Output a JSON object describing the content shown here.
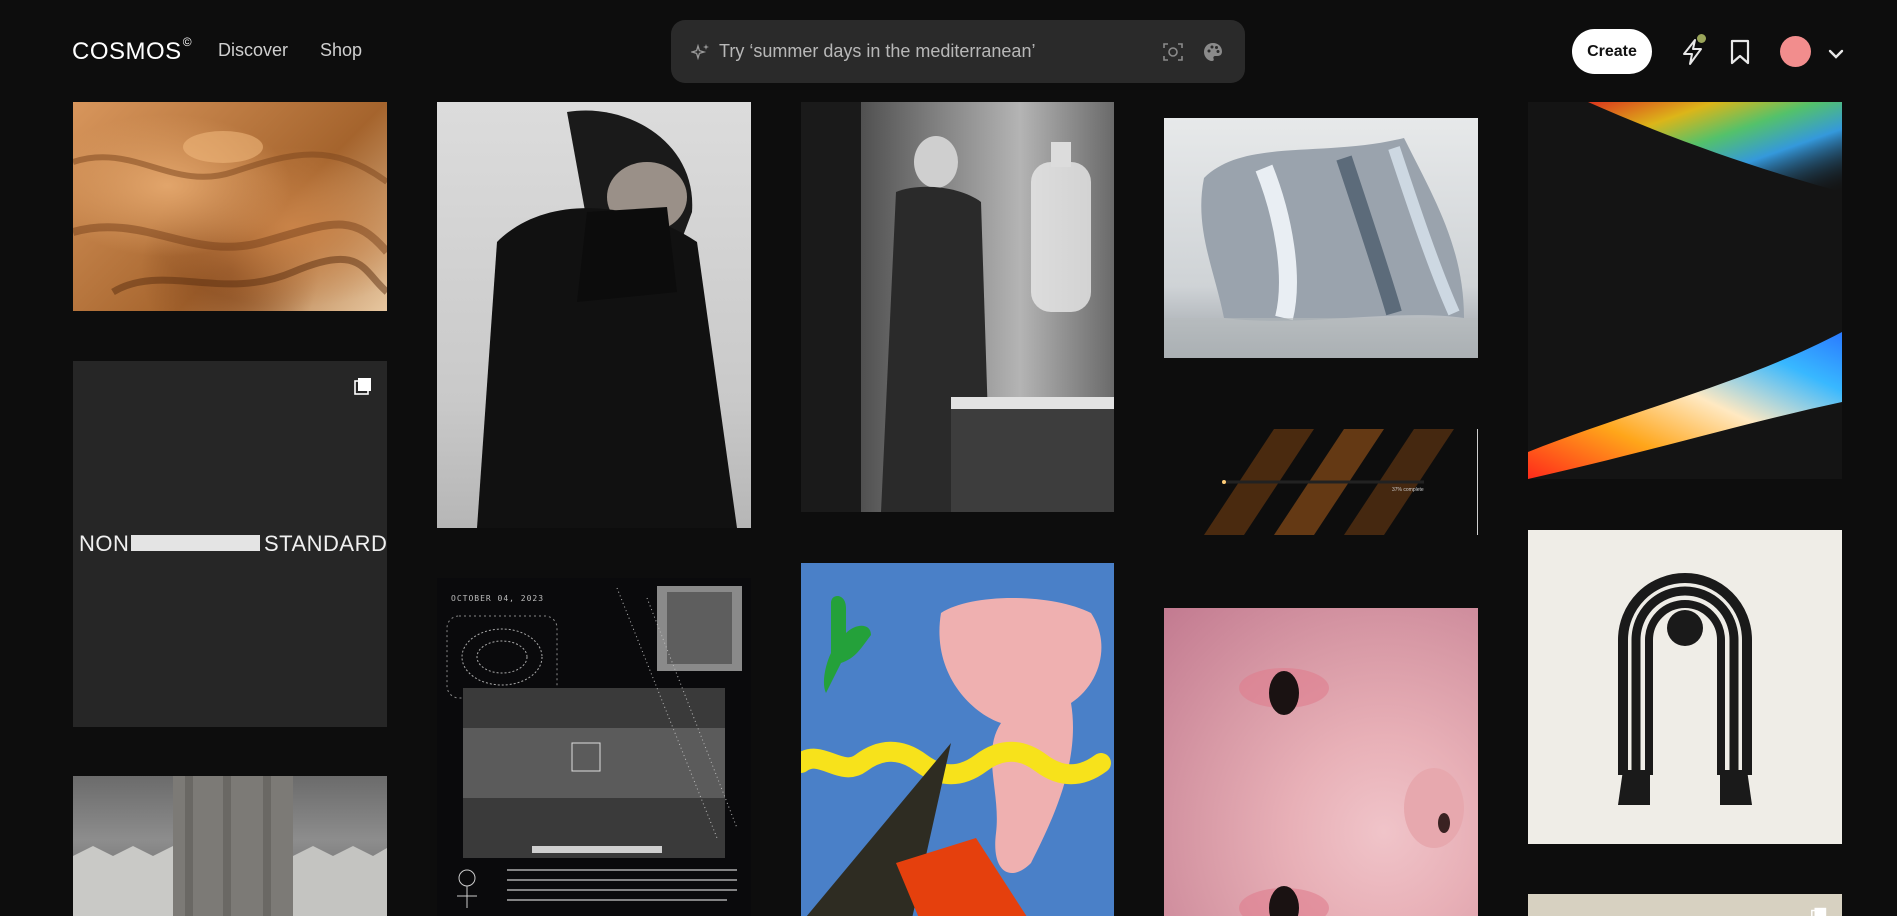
{
  "app": {
    "logo_text": "COSMOS",
    "logo_mark": "©"
  },
  "nav": {
    "discover": "Discover",
    "shop": "Shop"
  },
  "search": {
    "placeholder": "Try ‘summer days in the mediterranean’",
    "value": "",
    "icons": [
      "sparkle-icon",
      "visual-search-icon",
      "palette-icon"
    ]
  },
  "actions": {
    "create_label": "Create",
    "icons": [
      "bolt-icon",
      "bookmark-icon",
      "chevron-down-icon"
    ],
    "avatar_color": "#f28d8d",
    "notification_dot_color": "#9aa55a"
  },
  "tiles": {
    "non_standard": {
      "left": "NON",
      "right": "STANDARD"
    },
    "poster": {
      "date": "OCTOBER 04, 2023"
    },
    "loading_bar": {
      "caption": "37% complete"
    }
  },
  "colors": {
    "background": "#0d0d0d",
    "search_bg": "#2a2a2a"
  }
}
